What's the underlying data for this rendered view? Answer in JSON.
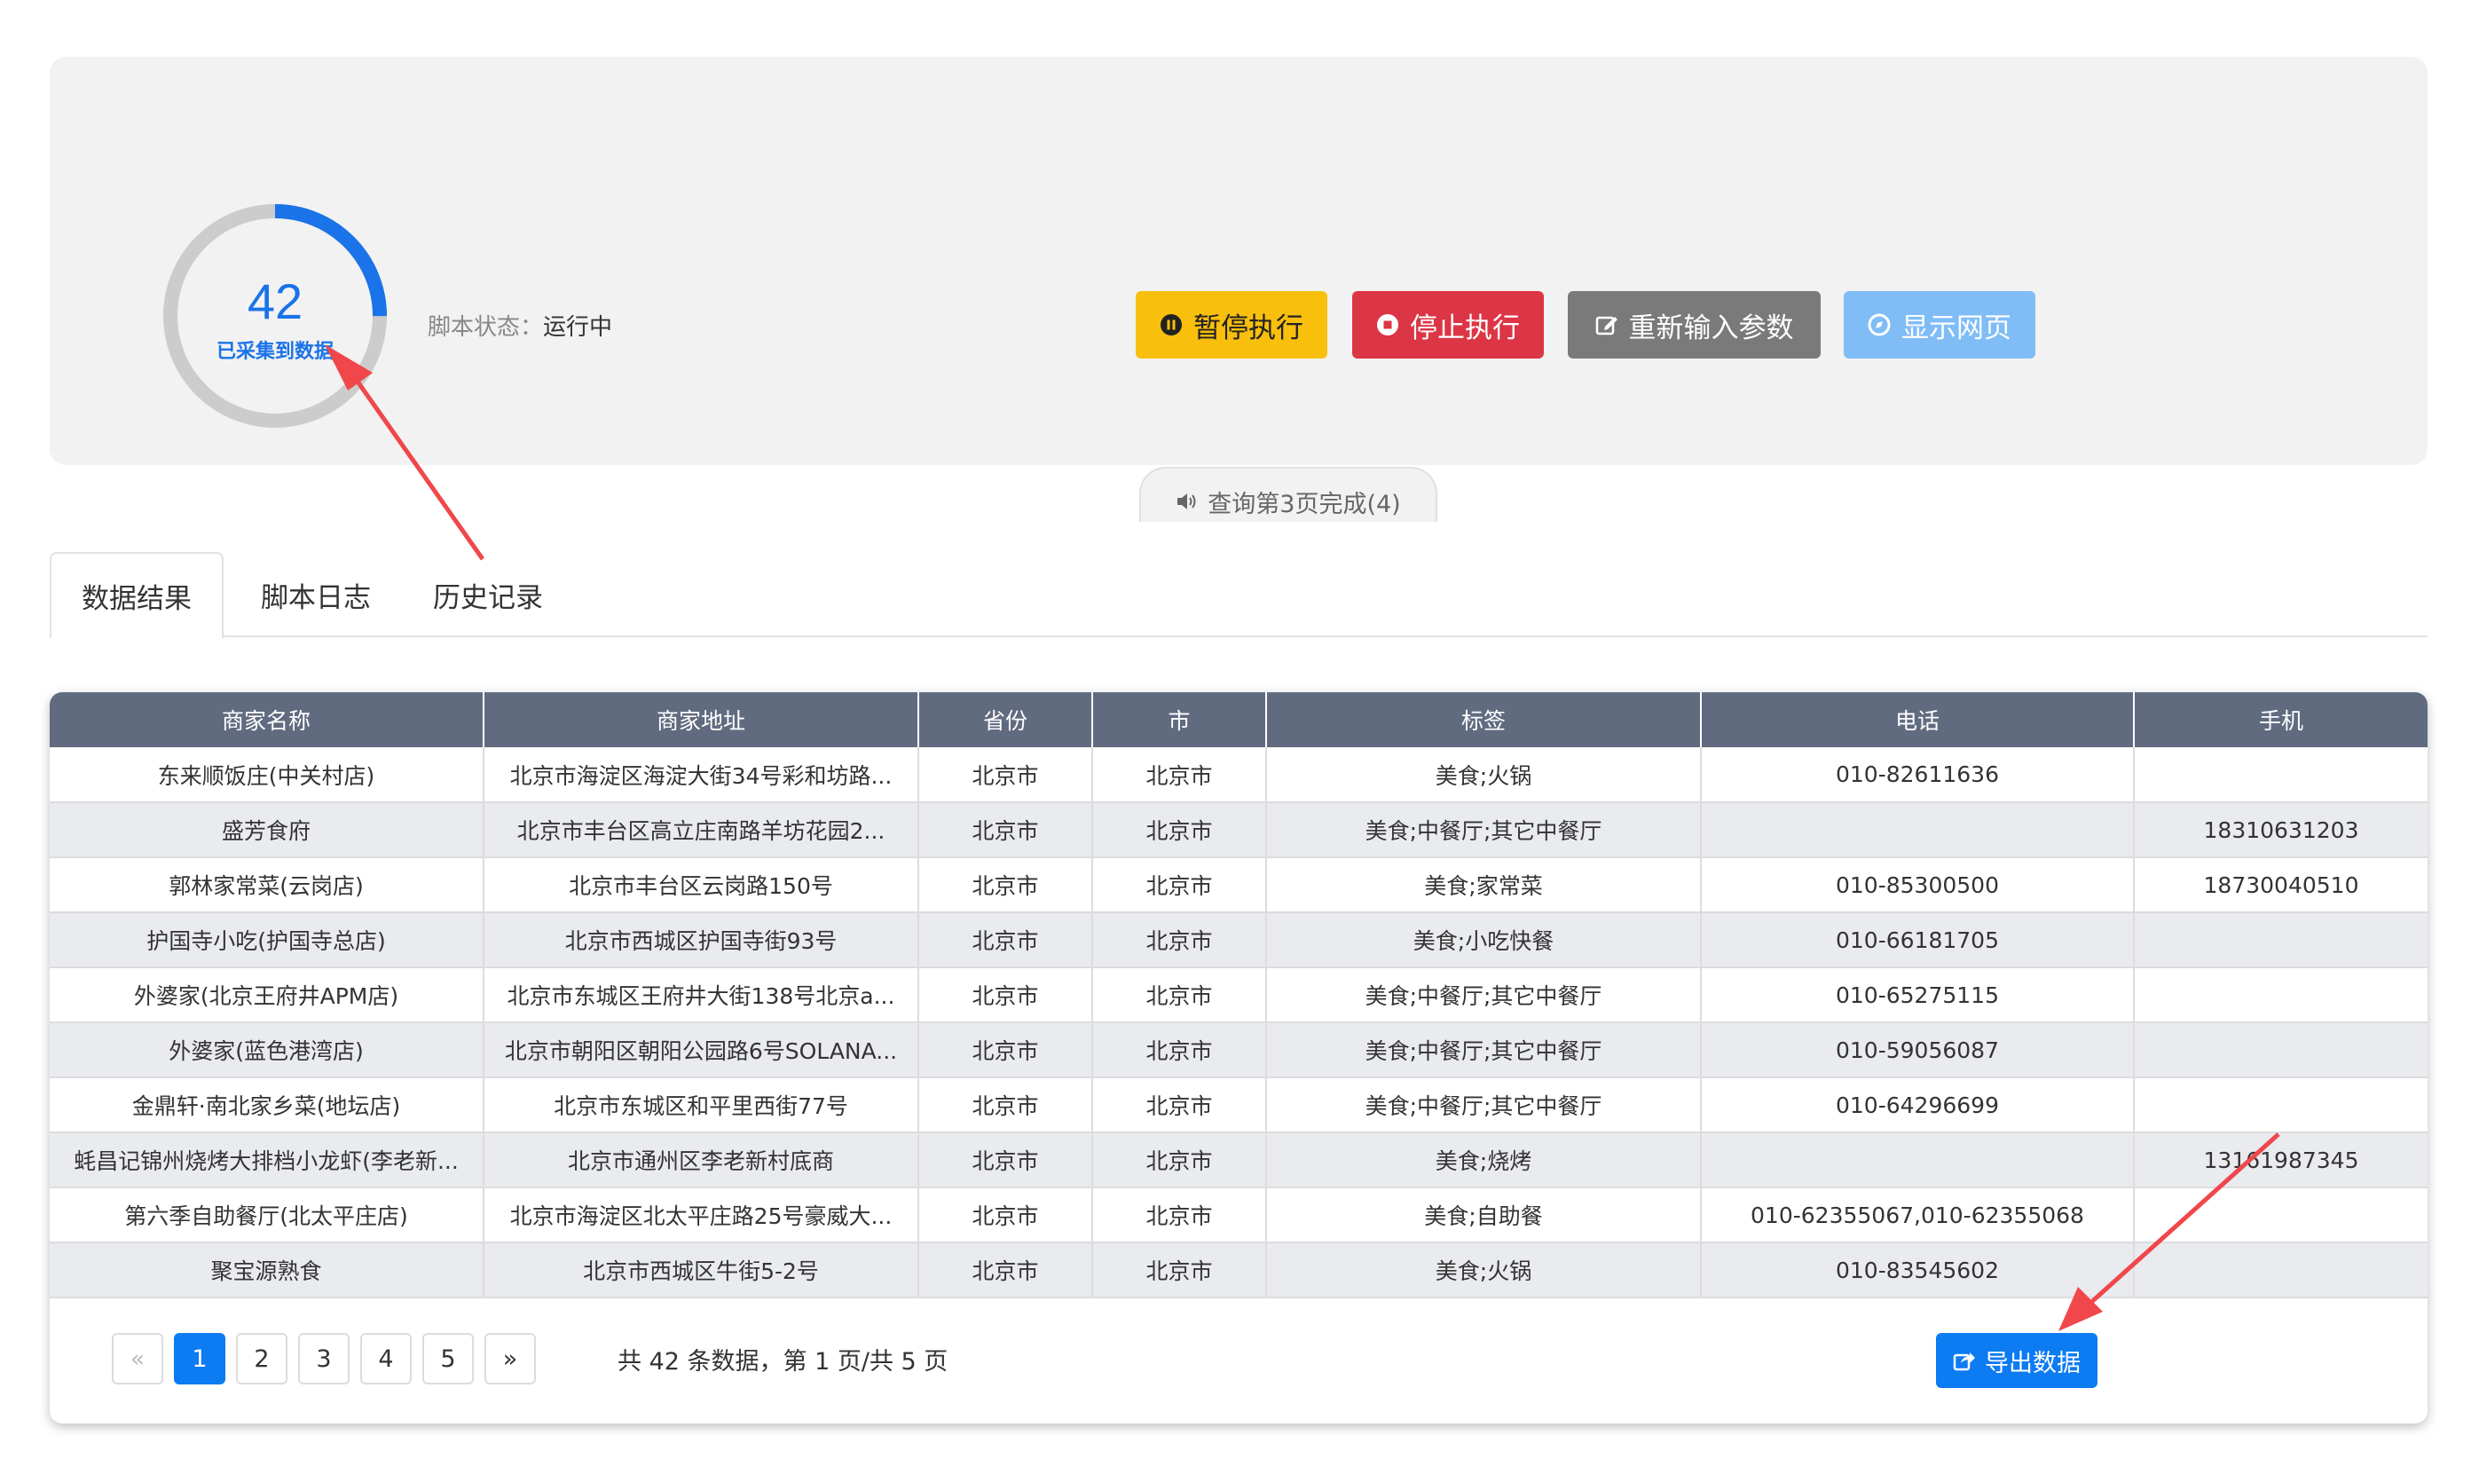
{
  "status": {
    "collected_count": "42",
    "collected_label": "已采集到数据",
    "progress_fraction": 0.25,
    "colors": {
      "ring_fill": "#1a73e8",
      "ring_track": "#cccccc"
    },
    "script_status_key": "脚本状态：",
    "script_status_value": "运行中"
  },
  "actions": {
    "pause": {
      "label": "暂停执行",
      "icon": "pause-circle-icon",
      "color": "#f8bf0c"
    },
    "stop": {
      "label": "停止执行",
      "icon": "stop-circle-icon",
      "color": "#dc3545"
    },
    "reinput": {
      "label": "重新输入参数",
      "icon": "edit-icon",
      "color": "#7a7a7a"
    },
    "show_page": {
      "label": "显示网页",
      "icon": "compass-icon",
      "color": "#80bdf7"
    }
  },
  "notice": {
    "icon": "volume-icon",
    "text": "查询第3页完成(4)"
  },
  "tabs": [
    {
      "label": "数据结果",
      "active": true
    },
    {
      "label": "脚本日志",
      "active": false
    },
    {
      "label": "历史记录",
      "active": false
    }
  ],
  "table": {
    "columns": [
      "商家名称",
      "商家地址",
      "省份",
      "市",
      "标签",
      "电话",
      "手机"
    ],
    "rows": [
      [
        "东来顺饭庄(中关村店)",
        "北京市海淀区海淀大街34号彩和坊路...",
        "北京市",
        "北京市",
        "美食;火锅",
        "010-82611636",
        ""
      ],
      [
        "盛芳食府",
        "北京市丰台区高立庄南路羊坊花园2...",
        "北京市",
        "北京市",
        "美食;中餐厅;其它中餐厅",
        "",
        "18310631203"
      ],
      [
        "郭林家常菜(云岗店)",
        "北京市丰台区云岗路150号",
        "北京市",
        "北京市",
        "美食;家常菜",
        "010-85300500",
        "18730040510"
      ],
      [
        "护国寺小吃(护国寺总店)",
        "北京市西城区护国寺街93号",
        "北京市",
        "北京市",
        "美食;小吃快餐",
        "010-66181705",
        ""
      ],
      [
        "外婆家(北京王府井APM店)",
        "北京市东城区王府井大街138号北京a...",
        "北京市",
        "北京市",
        "美食;中餐厅;其它中餐厅",
        "010-65275115",
        ""
      ],
      [
        "外婆家(蓝色港湾店)",
        "北京市朝阳区朝阳公园路6号SOLANA...",
        "北京市",
        "北京市",
        "美食;中餐厅;其它中餐厅",
        "010-59056087",
        ""
      ],
      [
        "金鼎轩·南北家乡菜(地坛店)",
        "北京市东城区和平里西街77号",
        "北京市",
        "北京市",
        "美食;中餐厅;其它中餐厅",
        "010-64296699",
        ""
      ],
      [
        "蚝昌记锦州烧烤大排档小龙虾(李老新...",
        "北京市通州区李老新村底商",
        "北京市",
        "北京市",
        "美食;烧烤",
        "",
        "13161987345"
      ],
      [
        "第六季自助餐厅(北太平庄店)",
        "北京市海淀区北太平庄路25号豪威大...",
        "北京市",
        "北京市",
        "美食;自助餐",
        "010-62355067,010-62355068",
        ""
      ],
      [
        "聚宝源熟食",
        "北京市西城区牛街5-2号",
        "北京市",
        "北京市",
        "美食;火锅",
        "010-83545602",
        ""
      ]
    ]
  },
  "pagination": {
    "prev": "«",
    "next": "»",
    "pages": [
      "1",
      "2",
      "3",
      "4",
      "5"
    ],
    "current": "1",
    "info": "共 42 条数据，第 1 页/共 5 页"
  },
  "export": {
    "label": "导出数据",
    "icon": "share-icon"
  },
  "annotations": {
    "arrow_color": "#f0474a"
  }
}
